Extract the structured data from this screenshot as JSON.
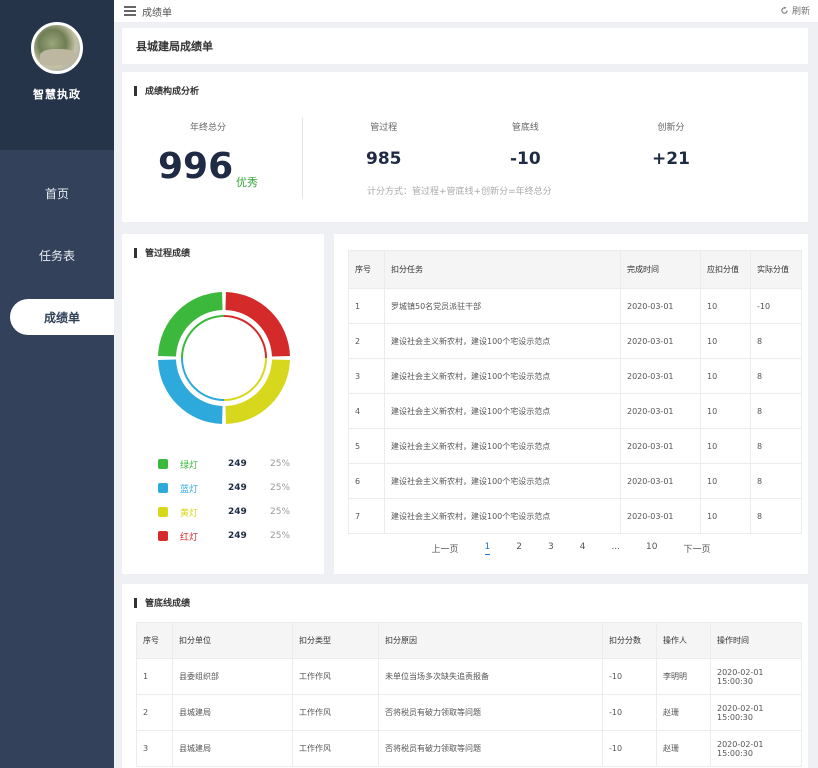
{
  "sidebar": {
    "brand": "智慧执政",
    "items": [
      {
        "label": "首页"
      },
      {
        "label": "任务表"
      },
      {
        "label": "成绩单"
      }
    ]
  },
  "topbar": {
    "crumb": "成绩单",
    "refresh": "刷新"
  },
  "page_title": "县城建局成绩单",
  "score": {
    "section_title": "成绩构成分析",
    "year_label": "年终总分",
    "year_value": "996",
    "year_level": "优秀",
    "metrics": [
      {
        "label": "管过程",
        "value": "985"
      },
      {
        "label": "管底线",
        "value": "-10"
      },
      {
        "label": "创新分",
        "value": "+21"
      }
    ],
    "formula": "计分方式：管过程+管底线+创新分=年终总分"
  },
  "process": {
    "section_title": "管过程成绩",
    "legend": [
      {
        "name": "绿灯",
        "count": "249",
        "pct": "25%",
        "color": "#3cb83c"
      },
      {
        "name": "蓝灯",
        "count": "249",
        "pct": "25%",
        "color": "#2ea9dc"
      },
      {
        "name": "黄灯",
        "count": "249",
        "pct": "25%",
        "color": "#d7d81e"
      },
      {
        "name": "红灯",
        "count": "249",
        "pct": "25%",
        "color": "#d42a2a"
      }
    ]
  },
  "tasks": {
    "headers": [
      "序号",
      "扣分任务",
      "完成时间",
      "应扣分值",
      "实际分值"
    ],
    "rows": [
      [
        "1",
        "罗城镇50名党员派驻干部",
        "2020-03-01",
        "10",
        "-10"
      ],
      [
        "2",
        "建设社会主义新农村，建设100个宅设示范点",
        "2020-03-01",
        "10",
        "8"
      ],
      [
        "3",
        "建设社会主义新农村，建设100个宅设示范点",
        "2020-03-01",
        "10",
        "8"
      ],
      [
        "4",
        "建设社会主义新农村，建设100个宅设示范点",
        "2020-03-01",
        "10",
        "8"
      ],
      [
        "5",
        "建设社会主义新农村，建设100个宅设示范点",
        "2020-03-01",
        "10",
        "8"
      ],
      [
        "6",
        "建设社会主义新农村，建设100个宅设示范点",
        "2020-03-01",
        "10",
        "8"
      ],
      [
        "7",
        "建设社会主义新农村，建设100个宅设示范点",
        "2020-03-01",
        "10",
        "8"
      ]
    ],
    "pager": {
      "prev": "上一页",
      "pages": [
        "1",
        "2",
        "3",
        "4",
        "...",
        "10"
      ],
      "next": "下一页"
    }
  },
  "penalty": {
    "section_title": "管底线成绩",
    "headers": [
      "序号",
      "扣分单位",
      "扣分类型",
      "扣分原因",
      "扣分分数",
      "操作人",
      "操作时间"
    ],
    "rows": [
      [
        "1",
        "县委组织部",
        "工作作风",
        "未单位当场多次缺失追责报备",
        "-10",
        "李明明",
        "2020-02-01 15:00:30"
      ],
      [
        "2",
        "县城建局",
        "工作作风",
        "否将税员有破力领取等问题",
        "-10",
        "赵珊",
        "2020-02-01 15:00:30"
      ],
      [
        "3",
        "县城建局",
        "工作作风",
        "否将税员有破力领取等问题",
        "-10",
        "赵珊",
        "2020-02-01 15:00:30"
      ]
    ]
  }
}
